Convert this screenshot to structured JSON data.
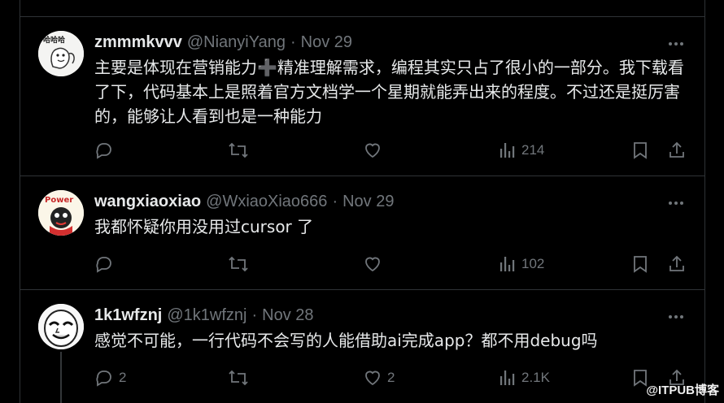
{
  "tweets": [
    {
      "name": "zmmmkvvv",
      "handle": "@NianyiYang",
      "separator": "·",
      "time": "Nov 29",
      "text": "主要是体现在营销能力➕精准理解需求，编程其实只占了很小的一部分。我下载看了下，代码基本上是照着官方文档学一个星期就能弄出来的程度。不过还是挺厉害的，能够让人看到也是一种能力",
      "replies": "",
      "retweets": "",
      "likes": "",
      "views": "214",
      "avatar_icon": "sketch-avatar-icon",
      "avatar_text": "哈哈哈"
    },
    {
      "name": "wangxiaoxiao",
      "handle": "@WxiaoXiao666",
      "separator": "·",
      "time": "Nov 29",
      "text": "我都怀疑你用没用过cursor 了",
      "replies": "",
      "retweets": "",
      "likes": "",
      "views": "102",
      "avatar_icon": "power-cartoon-avatar-icon",
      "avatar_text": "Power"
    },
    {
      "name": "1k1wfznj",
      "handle": "@1k1wfznj",
      "separator": "·",
      "time": "Nov 28",
      "text": "感觉不可能，一行代码不会写的人能借助ai完成app？都不用debug吗",
      "replies": "2",
      "retweets": "",
      "likes": "2",
      "views": "2.1K",
      "avatar_icon": "meme-face-avatar-icon",
      "avatar_text": ""
    }
  ],
  "watermark": "@ITPUB博客",
  "colors": {
    "background": "#000000",
    "border": "#2f3336",
    "text_primary": "#e7e9ea",
    "text_secondary": "#71767b"
  }
}
